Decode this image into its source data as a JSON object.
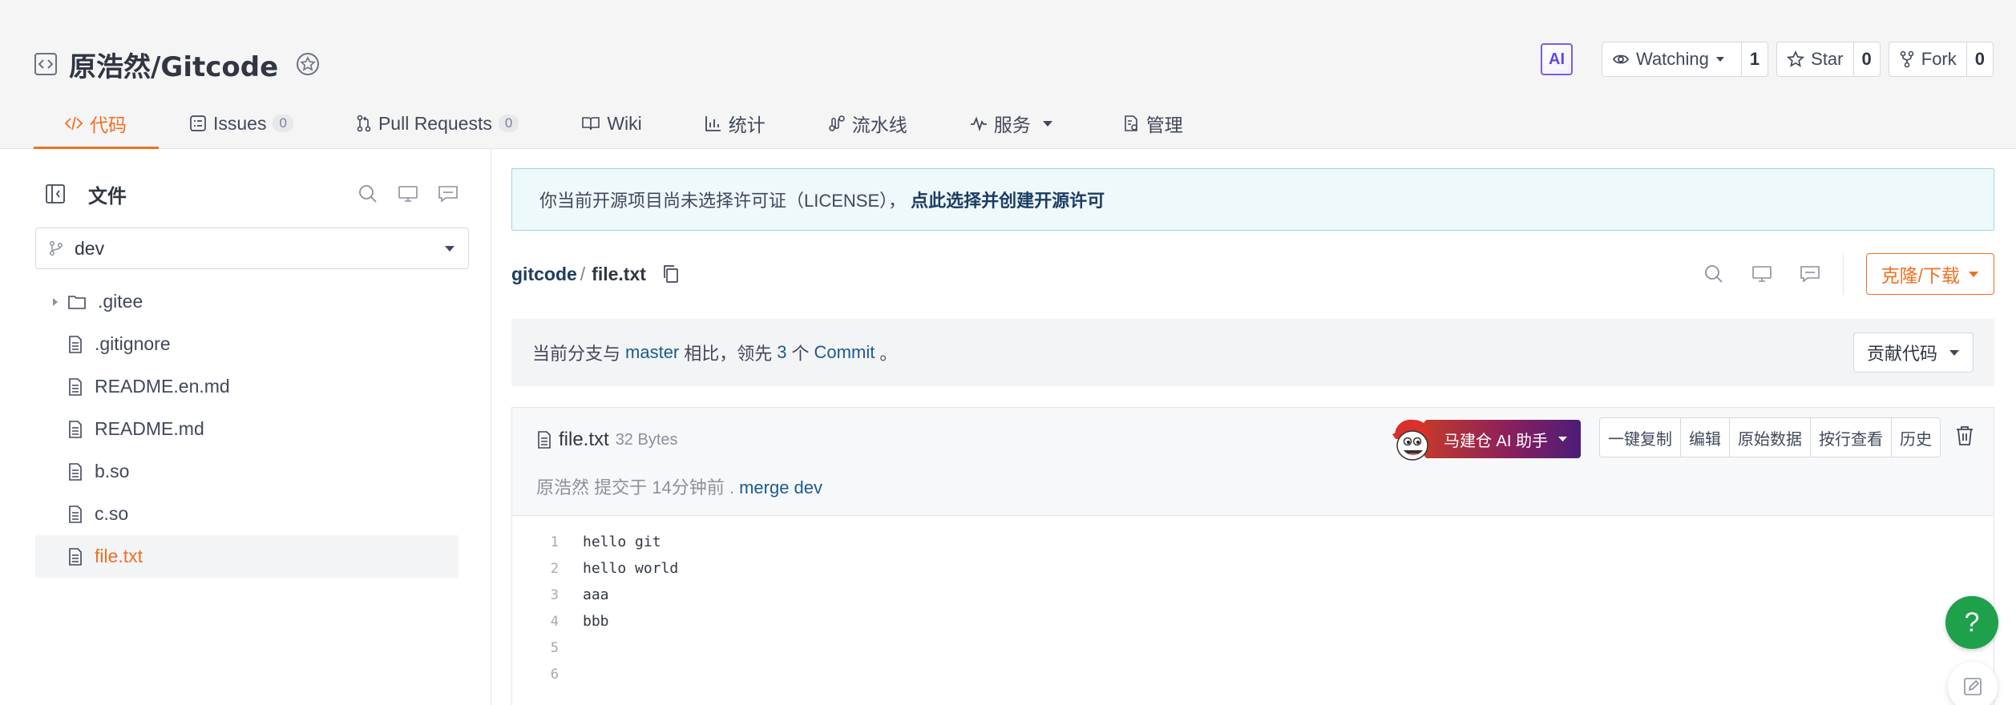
{
  "repo": {
    "title": "原浩然/Gitcode",
    "ai_badge": "AI",
    "watch": {
      "label": "Watching",
      "count": "1"
    },
    "star": {
      "label": "Star",
      "count": "0"
    },
    "fork": {
      "label": "Fork",
      "count": "0"
    }
  },
  "tabs": [
    {
      "label": "代码",
      "icon": "code-icon",
      "active": true
    },
    {
      "label": "Issues",
      "count": "0",
      "icon": "issues-icon"
    },
    {
      "label": "Pull Requests",
      "count": "0",
      "icon": "pull-request-icon"
    },
    {
      "label": "Wiki",
      "icon": "book-icon"
    },
    {
      "label": "统计",
      "icon": "chart-icon"
    },
    {
      "label": "流水线",
      "icon": "pipeline-icon"
    },
    {
      "label": "服务",
      "icon": "pulse-icon"
    },
    {
      "label": "管理",
      "icon": "settings-doc-icon"
    }
  ],
  "sidebar": {
    "title": "文件",
    "branch": "dev",
    "tree": [
      {
        "name": ".gitee",
        "type": "folder"
      },
      {
        "name": ".gitignore",
        "type": "file"
      },
      {
        "name": "README.en.md",
        "type": "file"
      },
      {
        "name": "README.md",
        "type": "file"
      },
      {
        "name": "b.so",
        "type": "file"
      },
      {
        "name": "c.so",
        "type": "file"
      },
      {
        "name": "file.txt",
        "type": "file",
        "active": true
      }
    ]
  },
  "notice": {
    "text": "你当前开源项目尚未选择许可证（LICENSE），",
    "link": "点此选择并创建开源许可"
  },
  "breadcrumb": {
    "root": "gitcode",
    "separator": "/",
    "file": "file.txt"
  },
  "clone_button": "克隆/下载",
  "compare": {
    "prefix": "当前分支与",
    "branch": "master",
    "middle": "相比，领先",
    "count": "3",
    "unit": "个",
    "commit": "Commit",
    "suffix": "。",
    "contribute_button": "贡献代码"
  },
  "file": {
    "name": "file.txt",
    "size": "32 Bytes",
    "commit_author": "原浩然",
    "commit_info": "提交于 14分钟前 .",
    "commit_message": "merge dev",
    "ai_helper": "马建仓 AI 助手",
    "actions": [
      "一键复制",
      "编辑",
      "原始数据",
      "按行查看",
      "历史"
    ],
    "lines": [
      {
        "n": "1",
        "text": "hello git"
      },
      {
        "n": "2",
        "text": "hello world"
      },
      {
        "n": "3",
        "text": "aaa"
      },
      {
        "n": "4",
        "text": "bbb"
      },
      {
        "n": "5",
        "text": ""
      },
      {
        "n": "6",
        "text": ""
      }
    ]
  },
  "help_button": "?",
  "colors": {
    "accent": "#f26f21",
    "link": "#1d5a8f",
    "help": "#1fa04b"
  }
}
